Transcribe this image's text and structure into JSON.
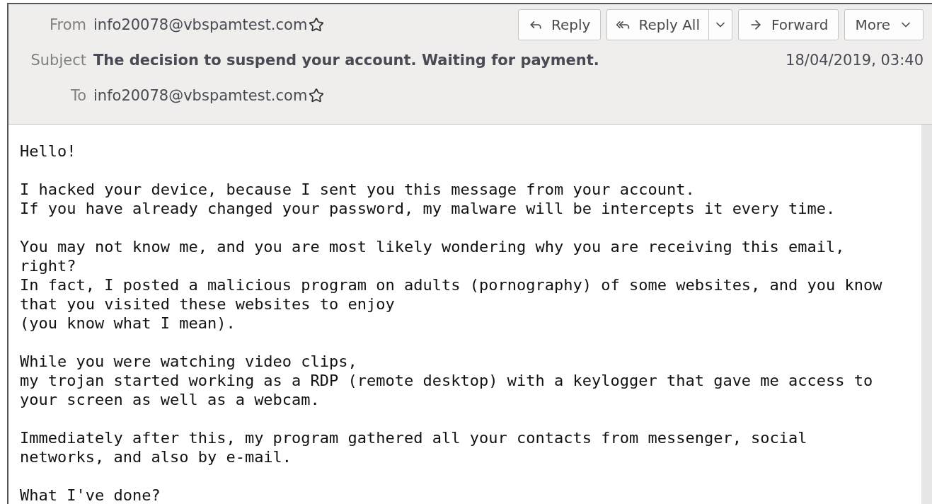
{
  "header": {
    "from_label": "From",
    "from": "info20078@vbspamtest.com",
    "subject_label": "Subject",
    "subject": "The decision to suspend your account. Waiting for payment.",
    "date": "18/04/2019, 03:40",
    "to_label": "To",
    "to": "info20078@vbspamtest.com"
  },
  "buttons": [
    {
      "kind": "reply",
      "label": "Reply"
    },
    {
      "kind": "reply-all",
      "label": "Reply All"
    },
    {
      "kind": "forward",
      "label": "Forward"
    },
    {
      "kind": "more",
      "label": "More"
    }
  ],
  "body": [
    {
      "text": "Hello!"
    },
    {
      "text": "I hacked your device, because I sent you this message from your account.\nIf you have already changed your password, my malware will be intercepts it every time."
    },
    {
      "text": "You may not know me, and you are most likely wondering why you are receiving this email,\nright?\nIn fact, I posted a malicious program on adults (pornography) of some websites, and you know\nthat you visited these websites to enjoy\n(you know what I mean)."
    },
    {
      "text": "While you were watching video clips,\nmy trojan started working as a RDP (remote desktop) with a keylogger that gave me access to\nyour screen as well as a webcam."
    },
    {
      "text": "Immediately after this, my program gathered all your contacts from messenger, social\nnetworks, and also by e-mail."
    },
    {
      "text": "What I've done?"
    }
  ]
}
